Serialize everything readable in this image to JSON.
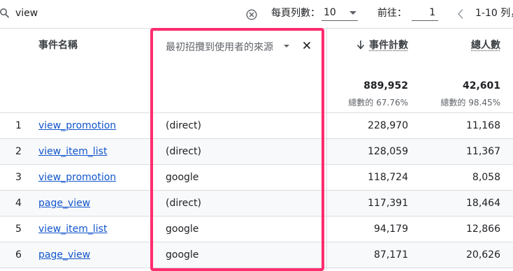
{
  "toolbar": {
    "search_value": "view",
    "rows_per_page_label": "每頁列數：",
    "rows_per_page_value": "10",
    "goto_label": "前往：",
    "goto_value": "1",
    "page_info": "1-10 列，"
  },
  "table": {
    "columns": {
      "event_name": "事件名稱",
      "source": "最初招攬到使用者的來源",
      "event_count": "事件計數",
      "total_users": "總人數"
    },
    "totals": {
      "event_count": "889,952",
      "event_count_pct": "總數的 67.76%",
      "total_users": "42,601",
      "total_users_pct": "總數的 98.45%"
    },
    "rows": [
      {
        "index": "1",
        "event": "view_promotion",
        "source": "(direct)",
        "count": "228,970",
        "users": "11,168"
      },
      {
        "index": "2",
        "event": "view_item_list",
        "source": "(direct)",
        "count": "128,059",
        "users": "11,367"
      },
      {
        "index": "3",
        "event": "view_promotion",
        "source": "google",
        "count": "118,724",
        "users": "8,058"
      },
      {
        "index": "4",
        "event": "page_view",
        "source": "(direct)",
        "count": "117,391",
        "users": "18,464"
      },
      {
        "index": "5",
        "event": "view_item_list",
        "source": "google",
        "count": "94,179",
        "users": "12,866"
      },
      {
        "index": "6",
        "event": "page_view",
        "source": "google",
        "count": "87,171",
        "users": "20,626"
      }
    ]
  },
  "colors": {
    "highlight": "#ff2d6f",
    "link": "#1155cc",
    "row_alt": "#f8f9fa",
    "divider": "#dadce0"
  }
}
